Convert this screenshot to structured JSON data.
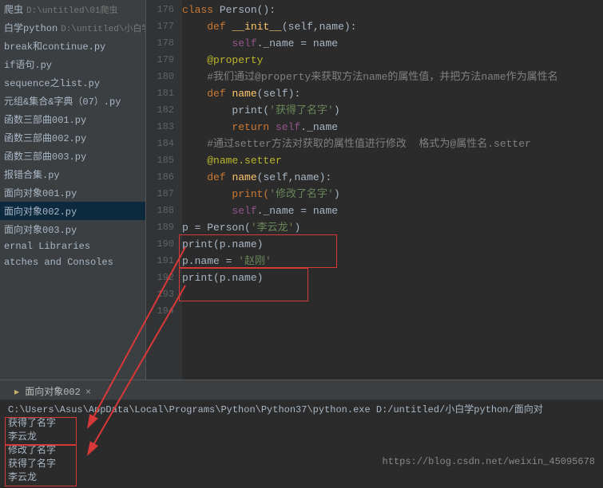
{
  "sidebar": {
    "items": [
      {
        "label": "爬虫",
        "path": "D:\\untitled\\01爬虫"
      },
      {
        "label": "白学python",
        "path": "D:\\untitled\\小白学py"
      },
      {
        "label": "break和continue.py",
        "path": ""
      },
      {
        "label": "if语句.py",
        "path": ""
      },
      {
        "label": "sequence之list.py",
        "path": ""
      },
      {
        "label": "元组&集合&字典（07）.py",
        "path": ""
      },
      {
        "label": "函数三部曲001.py",
        "path": ""
      },
      {
        "label": "函数三部曲002.py",
        "path": ""
      },
      {
        "label": "函数三部曲003.py",
        "path": ""
      },
      {
        "label": "报错合集.py",
        "path": ""
      },
      {
        "label": "面向对象001.py",
        "path": ""
      },
      {
        "label": "面向对象002.py",
        "path": ""
      },
      {
        "label": "面向对象003.py",
        "path": ""
      },
      {
        "label": "ernal Libraries",
        "path": ""
      },
      {
        "label": "atches and Consoles",
        "path": ""
      }
    ],
    "selected_index": 11
  },
  "editor": {
    "line_start": 176,
    "line_end": 194
  },
  "code_lines": {
    "l176": {
      "indent": "",
      "kw1": "class",
      "name": " Person():"
    },
    "l177": {
      "indent": "    ",
      "kw1": "def ",
      "fn": "__init__",
      "params": "(self,name):"
    },
    "l178": {
      "indent": "        ",
      "self": "self",
      "attr": "._name = name"
    },
    "l179": {
      "indent": "    ",
      "dec": "@property"
    },
    "l180": {
      "indent": "    ",
      "cmt": "#我们通过@property来获取方法name的属性值，并把方法name作为属性名"
    },
    "l181": {
      "indent": "    ",
      "kw1": "def ",
      "fn": "name",
      "params": "(self):"
    },
    "l182": {
      "indent": "        ",
      "call": "print(",
      "str": "'获得了名字'",
      "end": ")"
    },
    "l183": {
      "indent": "        ",
      "kw1": "return ",
      "self": "self",
      "attr": "._name"
    },
    "l184": {
      "indent": "    ",
      "cmt": "#通过setter方法对获取的属性值进行修改  格式为@属性名.setter"
    },
    "l185": {
      "indent": "    ",
      "dec": "@name.setter"
    },
    "l186": {
      "indent": "    ",
      "kw1": "def ",
      "fn": "name",
      "params": "(self,name):"
    },
    "l187": {
      "indent": "        ",
      "call": "print(",
      "str": "'修改了名字'",
      "end": ")"
    },
    "l188": {
      "indent": "        ",
      "self": "self",
      "attr": "._name = name"
    },
    "l190": {
      "text": "p = Person(",
      "str": "'李云龙'",
      "end": ")"
    },
    "l191": {
      "text": "print(p.name)"
    },
    "l192": {
      "text": "p.name = ",
      "str": "'赵刚'"
    },
    "l193": {
      "text": "print(p.name)"
    }
  },
  "console": {
    "tab_label": "面向对象002",
    "path": "C:\\Users\\Asus\\AppData\\Local\\Programs\\Python\\Python37\\python.exe D:/untitled/小白学python/面向对",
    "out1": "获得了名字",
    "out2": "李云龙",
    "out3": "修改了名字",
    "out4": "获得了名字",
    "out5": "李云龙"
  },
  "watermark": "https://blog.csdn.net/weixin_45095678"
}
